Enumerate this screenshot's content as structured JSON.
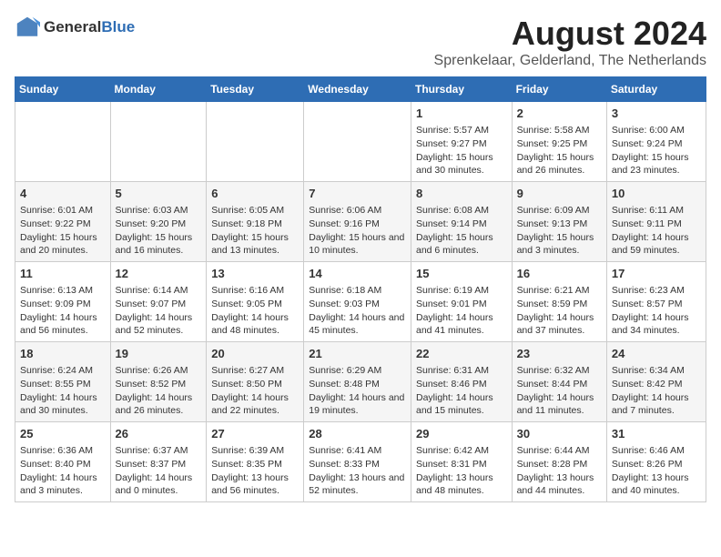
{
  "logo": {
    "text_general": "General",
    "text_blue": "Blue"
  },
  "title": "August 2024",
  "subtitle": "Sprenkelaar, Gelderland, The Netherlands",
  "days_of_week": [
    "Sunday",
    "Monday",
    "Tuesday",
    "Wednesday",
    "Thursday",
    "Friday",
    "Saturday"
  ],
  "weeks": [
    [
      {
        "day": "",
        "info": ""
      },
      {
        "day": "",
        "info": ""
      },
      {
        "day": "",
        "info": ""
      },
      {
        "day": "",
        "info": ""
      },
      {
        "day": "1",
        "info": "Sunrise: 5:57 AM\nSunset: 9:27 PM\nDaylight: 15 hours and 30 minutes."
      },
      {
        "day": "2",
        "info": "Sunrise: 5:58 AM\nSunset: 9:25 PM\nDaylight: 15 hours and 26 minutes."
      },
      {
        "day": "3",
        "info": "Sunrise: 6:00 AM\nSunset: 9:24 PM\nDaylight: 15 hours and 23 minutes."
      }
    ],
    [
      {
        "day": "4",
        "info": "Sunrise: 6:01 AM\nSunset: 9:22 PM\nDaylight: 15 hours and 20 minutes."
      },
      {
        "day": "5",
        "info": "Sunrise: 6:03 AM\nSunset: 9:20 PM\nDaylight: 15 hours and 16 minutes."
      },
      {
        "day": "6",
        "info": "Sunrise: 6:05 AM\nSunset: 9:18 PM\nDaylight: 15 hours and 13 minutes."
      },
      {
        "day": "7",
        "info": "Sunrise: 6:06 AM\nSunset: 9:16 PM\nDaylight: 15 hours and 10 minutes."
      },
      {
        "day": "8",
        "info": "Sunrise: 6:08 AM\nSunset: 9:14 PM\nDaylight: 15 hours and 6 minutes."
      },
      {
        "day": "9",
        "info": "Sunrise: 6:09 AM\nSunset: 9:13 PM\nDaylight: 15 hours and 3 minutes."
      },
      {
        "day": "10",
        "info": "Sunrise: 6:11 AM\nSunset: 9:11 PM\nDaylight: 14 hours and 59 minutes."
      }
    ],
    [
      {
        "day": "11",
        "info": "Sunrise: 6:13 AM\nSunset: 9:09 PM\nDaylight: 14 hours and 56 minutes."
      },
      {
        "day": "12",
        "info": "Sunrise: 6:14 AM\nSunset: 9:07 PM\nDaylight: 14 hours and 52 minutes."
      },
      {
        "day": "13",
        "info": "Sunrise: 6:16 AM\nSunset: 9:05 PM\nDaylight: 14 hours and 48 minutes."
      },
      {
        "day": "14",
        "info": "Sunrise: 6:18 AM\nSunset: 9:03 PM\nDaylight: 14 hours and 45 minutes."
      },
      {
        "day": "15",
        "info": "Sunrise: 6:19 AM\nSunset: 9:01 PM\nDaylight: 14 hours and 41 minutes."
      },
      {
        "day": "16",
        "info": "Sunrise: 6:21 AM\nSunset: 8:59 PM\nDaylight: 14 hours and 37 minutes."
      },
      {
        "day": "17",
        "info": "Sunrise: 6:23 AM\nSunset: 8:57 PM\nDaylight: 14 hours and 34 minutes."
      }
    ],
    [
      {
        "day": "18",
        "info": "Sunrise: 6:24 AM\nSunset: 8:55 PM\nDaylight: 14 hours and 30 minutes."
      },
      {
        "day": "19",
        "info": "Sunrise: 6:26 AM\nSunset: 8:52 PM\nDaylight: 14 hours and 26 minutes."
      },
      {
        "day": "20",
        "info": "Sunrise: 6:27 AM\nSunset: 8:50 PM\nDaylight: 14 hours and 22 minutes."
      },
      {
        "day": "21",
        "info": "Sunrise: 6:29 AM\nSunset: 8:48 PM\nDaylight: 14 hours and 19 minutes."
      },
      {
        "day": "22",
        "info": "Sunrise: 6:31 AM\nSunset: 8:46 PM\nDaylight: 14 hours and 15 minutes."
      },
      {
        "day": "23",
        "info": "Sunrise: 6:32 AM\nSunset: 8:44 PM\nDaylight: 14 hours and 11 minutes."
      },
      {
        "day": "24",
        "info": "Sunrise: 6:34 AM\nSunset: 8:42 PM\nDaylight: 14 hours and 7 minutes."
      }
    ],
    [
      {
        "day": "25",
        "info": "Sunrise: 6:36 AM\nSunset: 8:40 PM\nDaylight: 14 hours and 3 minutes."
      },
      {
        "day": "26",
        "info": "Sunrise: 6:37 AM\nSunset: 8:37 PM\nDaylight: 14 hours and 0 minutes."
      },
      {
        "day": "27",
        "info": "Sunrise: 6:39 AM\nSunset: 8:35 PM\nDaylight: 13 hours and 56 minutes."
      },
      {
        "day": "28",
        "info": "Sunrise: 6:41 AM\nSunset: 8:33 PM\nDaylight: 13 hours and 52 minutes."
      },
      {
        "day": "29",
        "info": "Sunrise: 6:42 AM\nSunset: 8:31 PM\nDaylight: 13 hours and 48 minutes."
      },
      {
        "day": "30",
        "info": "Sunrise: 6:44 AM\nSunset: 8:28 PM\nDaylight: 13 hours and 44 minutes."
      },
      {
        "day": "31",
        "info": "Sunrise: 6:46 AM\nSunset: 8:26 PM\nDaylight: 13 hours and 40 minutes."
      }
    ]
  ]
}
